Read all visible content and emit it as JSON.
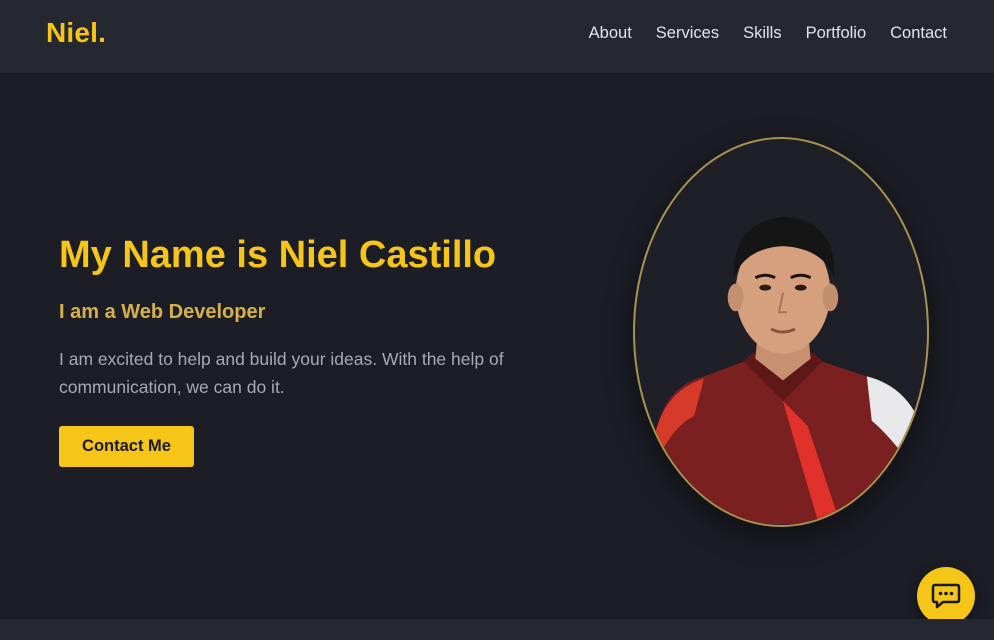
{
  "brand": {
    "logo": "Niel."
  },
  "nav": {
    "items": [
      {
        "label": "About"
      },
      {
        "label": "Services"
      },
      {
        "label": "Skills"
      },
      {
        "label": "Portfolio"
      },
      {
        "label": "Contact"
      }
    ]
  },
  "hero": {
    "title": "My Name is Niel Castillo",
    "subtitle": "I am a Web Developer",
    "description": "I am excited to help and build your ideas. With the help of communication, we can do it.",
    "cta_label": "Contact Me"
  },
  "icons": {
    "chat": "chat-bubble-icon"
  },
  "colors": {
    "accent": "#f5c518",
    "subtitle": "#d4b14a",
    "background": "#1c1d25",
    "navbar": "#252830",
    "portrait_border": "#a8924f"
  }
}
